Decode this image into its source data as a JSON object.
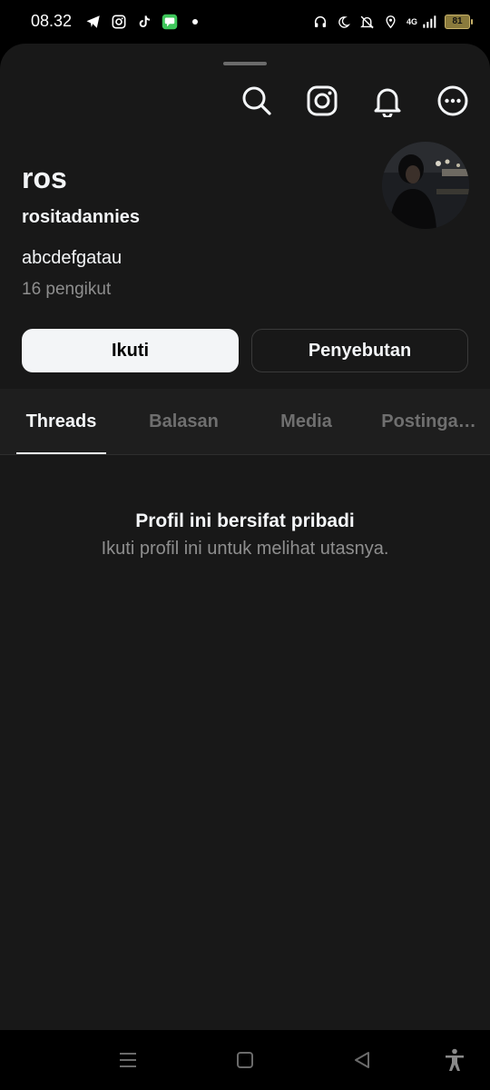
{
  "status_bar": {
    "time": "08.32",
    "battery": "81",
    "network": "4G",
    "left_icons": [
      "telegram-icon",
      "instagram-icon",
      "tiktok-icon",
      "message-app-icon",
      "dot-icon"
    ],
    "right_icons": [
      "headphones-icon",
      "moon-icon",
      "mute-icon",
      "location-icon",
      "signal-icon",
      "battery-icon"
    ]
  },
  "top_actions": [
    "search-icon",
    "instagram-icon",
    "bell-icon",
    "more-icon"
  ],
  "profile": {
    "name": "ros",
    "username": "rositadannies",
    "bio": "abcdefgatau",
    "followers": "16 pengikut"
  },
  "buttons": {
    "follow": "Ikuti",
    "mention": "Penyebutan"
  },
  "tabs": [
    {
      "label": "Threads",
      "active": true
    },
    {
      "label": "Balasan",
      "active": false
    },
    {
      "label": "Media",
      "active": false
    },
    {
      "label": "Postinga…",
      "active": false
    }
  ],
  "empty_state": {
    "title": "Profil ini bersifat pribadi",
    "subtitle": "Ikuti profil ini untuk melihat utasnya."
  },
  "nav": [
    "recents-icon",
    "home-icon",
    "back-icon",
    "accessibility-icon"
  ],
  "colors": {
    "background": "#000000",
    "sheet": "#181818",
    "text_primary": "#f3f5f7",
    "text_secondary": "#8e8e8e",
    "battery": "#c9b36a"
  }
}
